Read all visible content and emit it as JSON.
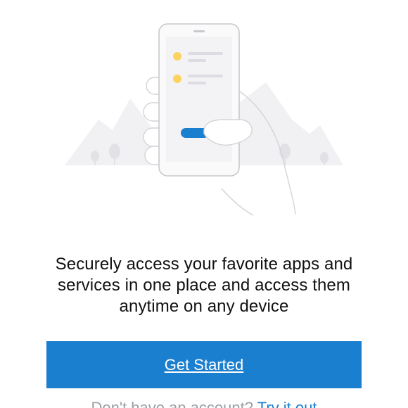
{
  "colors": {
    "primary": "#1b7fd0",
    "accent_dot": "#fbd35f",
    "illustration_bg": "#f1f1f4",
    "phone_frame": "#c9c9ce",
    "muted_text": "#9aa0a6"
  },
  "illustration": {
    "icon": "phone-in-hand-illustration"
  },
  "onboarding": {
    "headline": "Securely access your favorite apps and services in one place and access them anytime on any device",
    "primary_button_label": "Get Started",
    "secondary_muted_text": "Don't have an account?",
    "secondary_link_text": "Try it out"
  }
}
